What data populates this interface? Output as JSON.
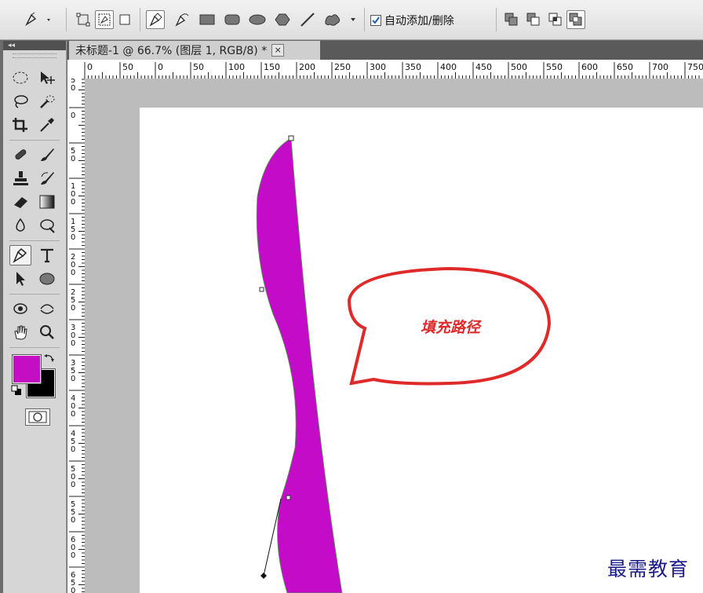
{
  "options_bar": {
    "auto_add_delete_label": "自动添加/删除",
    "auto_add_delete_checked": true,
    "tool_icons": [
      "pen-tool-icon",
      "shape-layers-icon",
      "paths-icon",
      "fill-pixels-icon",
      "pen-icon",
      "freeform-pen-icon",
      "rectangle-icon",
      "rounded-rectangle-icon",
      "ellipse-icon",
      "polygon-icon",
      "line-icon",
      "custom-shape-icon"
    ],
    "combine_icons": [
      "add-to-shape-area-icon",
      "subtract-from-shape-area-icon",
      "intersect-shape-areas-icon",
      "exclude-overlapping-icon"
    ]
  },
  "document": {
    "tab_title": "未标题-1 @ 66.7% (图层 1, RGB/8) *",
    "close_symbol": "×"
  },
  "ruler": {
    "h_labels": [
      "0",
      "50",
      "0",
      "50",
      "100",
      "150",
      "200",
      "250",
      "300",
      "350",
      "400",
      "450",
      "500",
      "550",
      "600",
      "650",
      "700",
      "750"
    ],
    "v_labels": [
      "50",
      "0",
      "50",
      "100",
      "150",
      "200",
      "250",
      "300",
      "350",
      "400",
      "450",
      "500",
      "550",
      "600",
      "650"
    ]
  },
  "toolpanel": {
    "collapse_label": "◂◂",
    "foreground_color": "#c30ec3",
    "background_color": "#000000"
  },
  "canvas": {
    "fill_color": "#c40bc7",
    "bubble_text": "填充路径",
    "bubble_color": "#e02a2a"
  },
  "watermark": "最需教育"
}
